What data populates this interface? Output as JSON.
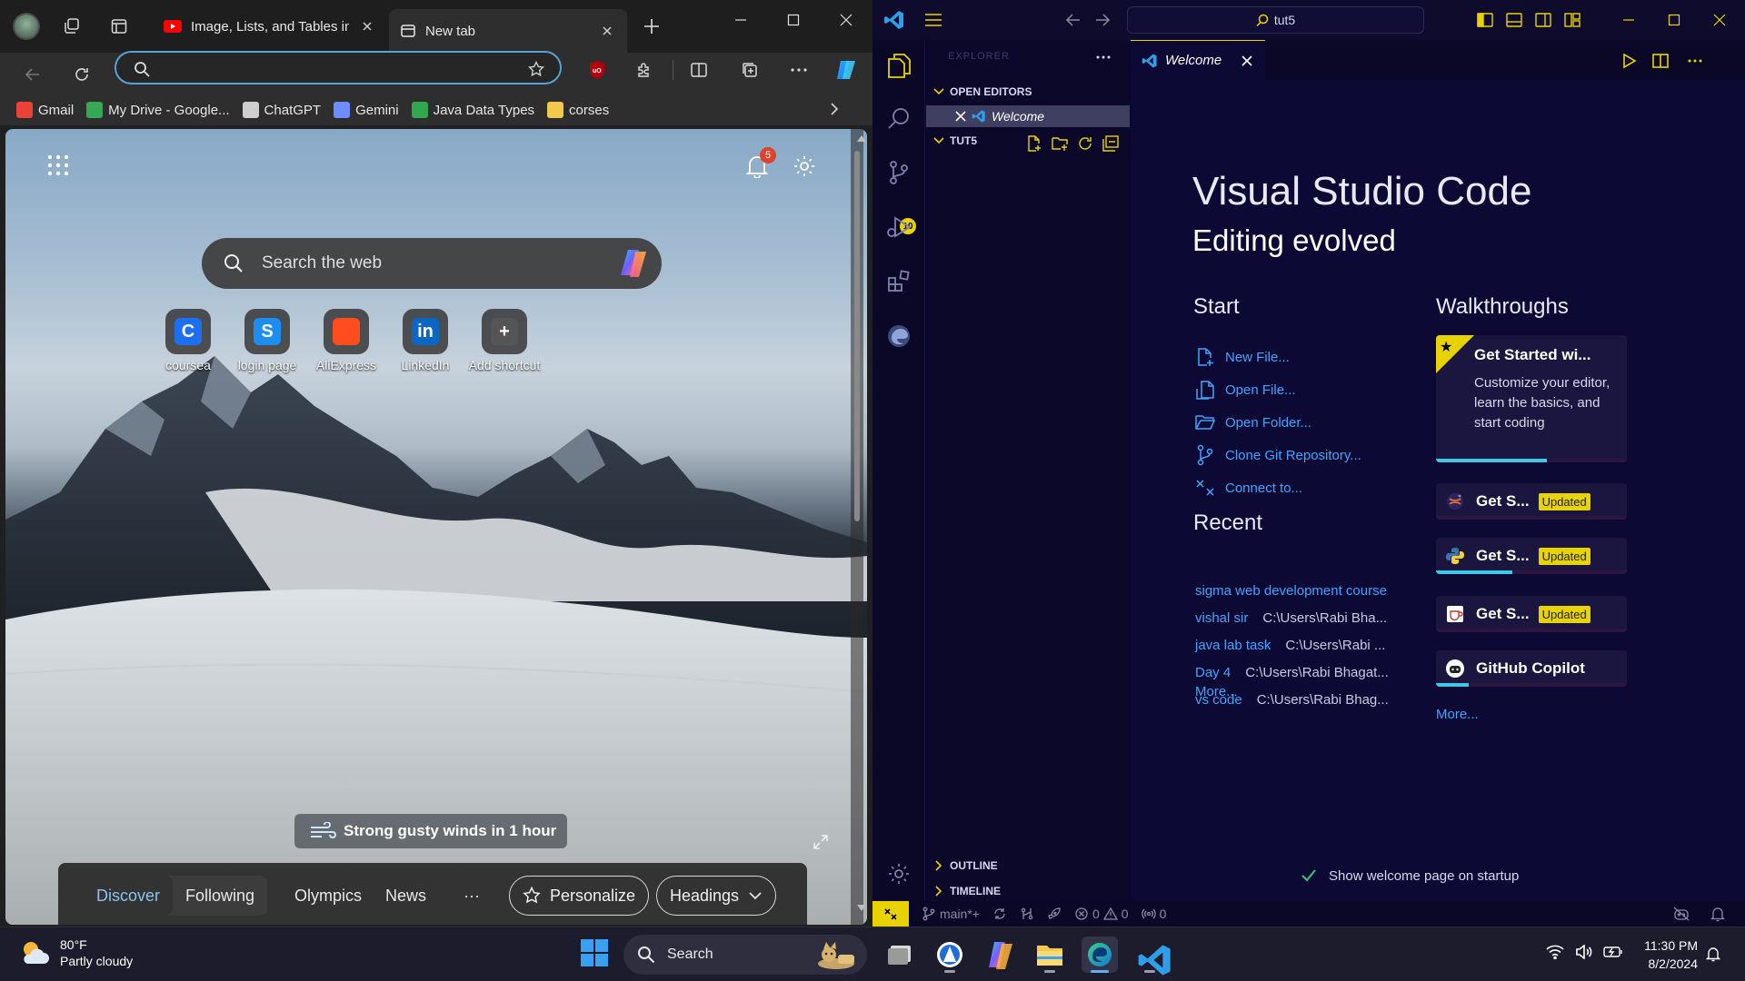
{
  "edge": {
    "tabs": [
      {
        "title": "Image, Lists, and Tables in H",
        "favicon": "youtube-icon"
      },
      {
        "title": "New tab",
        "favicon": "newtab-icon"
      }
    ],
    "address_value": "",
    "bookmarks": [
      {
        "label": "Gmail",
        "icon": "gmail-icon",
        "color": "#ea4335"
      },
      {
        "label": "My Drive - Google...",
        "icon": "drive-icon",
        "color": "#34a853"
      },
      {
        "label": "ChatGPT",
        "icon": "chatgpt-icon",
        "color": "#cfcfcf"
      },
      {
        "label": "Gemini",
        "icon": "gemini-icon",
        "color": "#6f8cff"
      },
      {
        "label": "Java Data Types",
        "icon": "w-icon",
        "color": "#2fa84f"
      },
      {
        "label": "corses",
        "icon": "folder-icon",
        "color": "#f2c94c"
      }
    ],
    "newtab": {
      "search_placeholder": "Search the web",
      "notification_count": "5",
      "shortcuts": [
        {
          "label": "coursea",
          "glyph": "C",
          "color": "#1b6ff0"
        },
        {
          "label": "login page",
          "glyph": "S",
          "color": "#1d8ef0"
        },
        {
          "label": "AliExpress",
          "glyph": "",
          "color": "#ff4d1f"
        },
        {
          "label": "LinkedIn",
          "glyph": "in",
          "color": "#0a66c2"
        },
        {
          "label": "Add shortcut",
          "glyph": "+",
          "color": "#555555"
        }
      ],
      "weather_alert": "Strong gusty winds in 1 hour",
      "feed_tabs": {
        "discover": "Discover",
        "following": "Following",
        "olympics": "Olympics",
        "news": "News",
        "more": "···"
      },
      "personalize_label": "Personalize",
      "headings_label": "Headings"
    }
  },
  "vscode": {
    "command_center": "tut5",
    "accent_color": "#e8d300",
    "scm_badge": "10",
    "sidebar": {
      "header": "EXPLORER",
      "open_editors_label": "OPEN EDITORS",
      "open_editor_item": "Welcome",
      "folder_label": "TUT5",
      "outline_label": "OUTLINE",
      "timeline_label": "TIMELINE"
    },
    "tab_label": "Welcome",
    "welcome": {
      "title": "Visual Studio Code",
      "subtitle": "Editing evolved",
      "start_heading": "Start",
      "start_items": [
        "New File...",
        "Open File...",
        "Open Folder...",
        "Clone Git Repository...",
        "Connect to..."
      ],
      "recent_heading": "Recent",
      "recent_items": [
        {
          "name": "sigma web development course",
          "path": ""
        },
        {
          "name": "vishal sir",
          "path": "C:\\Users\\Rabi Bha..."
        },
        {
          "name": "java lab task",
          "path": "C:\\Users\\Rabi ..."
        },
        {
          "name": "Day 4",
          "path": "C:\\Users\\Rabi Bhagat..."
        },
        {
          "name": "vs code",
          "path": "C:\\Users\\Rabi Bhag..."
        }
      ],
      "recent_more": "More...",
      "walkthroughs_heading": "Walkthroughs",
      "walkthrough_main": {
        "title": "Get Started wi...",
        "description": "Customize your editor, learn the basics, and start coding",
        "progress": 0.58
      },
      "walkthroughs": [
        {
          "title": "Get S...",
          "badge": "Updated",
          "icon": "jupyter-icon",
          "progress": 0
        },
        {
          "title": "Get S...",
          "badge": "Updated",
          "icon": "python-icon",
          "progress": 0.4
        },
        {
          "title": "Get S...",
          "badge": "Updated",
          "icon": "cup-icon",
          "progress": 0
        },
        {
          "title": "GitHub Copilot",
          "badge": "",
          "icon": "copilot-icon",
          "progress": 0.17
        }
      ],
      "walkthroughs_more": "More...",
      "show_on_startup": "Show welcome page on startup"
    },
    "status": {
      "branch": "main*+",
      "errors": "0",
      "warnings": "0",
      "ports": "0"
    }
  },
  "taskbar": {
    "temperature": "80°F",
    "condition": "Partly cloudy",
    "search_label": "Search",
    "time": "11:30 PM",
    "date": "8/2/2024"
  }
}
